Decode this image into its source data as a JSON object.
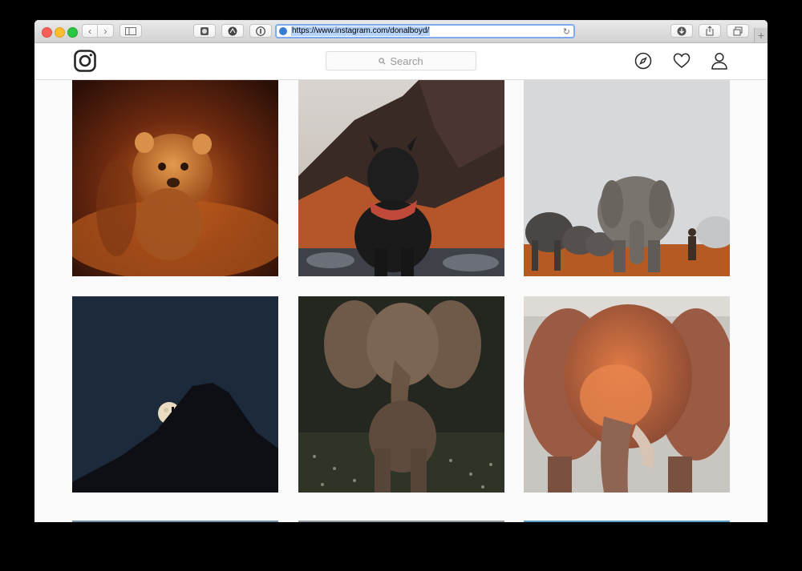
{
  "browser": {
    "url": "https://www.instagram.com/donalboyd/",
    "tab_plus": "+"
  },
  "header": {
    "search_placeholder": "Search"
  },
  "icons": [
    "instagram-logo-icon",
    "search-icon",
    "compass-icon",
    "heart-icon",
    "person-icon"
  ],
  "colors": {
    "accent": "#7daaf0",
    "header_bg": "#ffffff",
    "page_bg": "#fafafa"
  },
  "posts": [
    {
      "subject": "cheetah-cub"
    },
    {
      "subject": "french-bulldog"
    },
    {
      "subject": "elephant-herd"
    },
    {
      "subject": "moon-over-mountain"
    },
    {
      "subject": "elephant-dark"
    },
    {
      "subject": "elephant-dust"
    }
  ]
}
